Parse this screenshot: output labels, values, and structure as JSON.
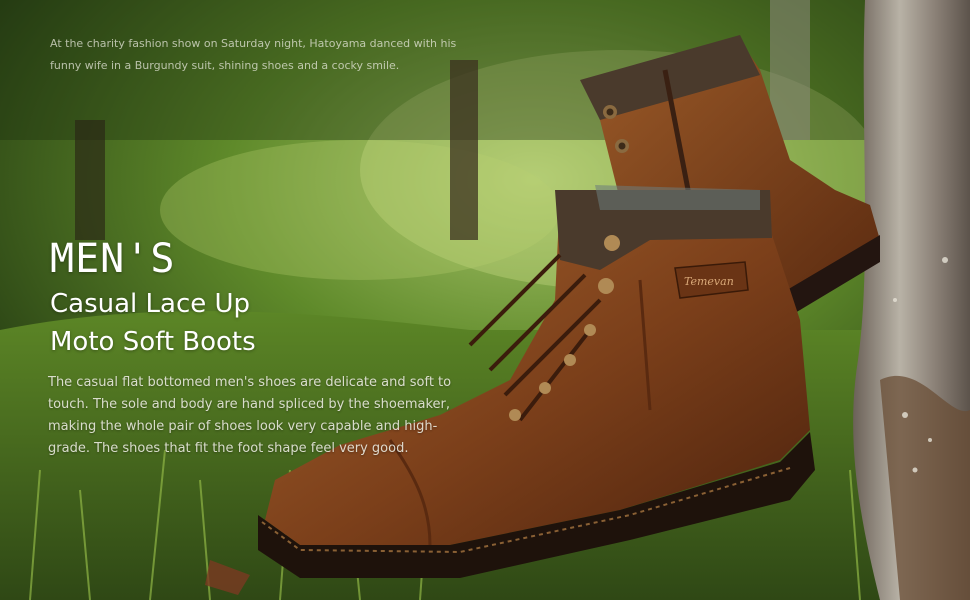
{
  "banner": {
    "quote": "At the charity fashion show on Saturday night, Hatoyama danced with his funny wife in a Burgundy suit, shining shoes and a cocky smile.",
    "headline": "MEN'S",
    "subtitle_line1": "Casual Lace Up",
    "subtitle_line2": "Moto Soft Boots",
    "description": "The casual flat bottomed men's shoes are delicate and soft to touch. The sole and body are hand spliced by the shoemaker, making the whole pair of shoes look very capable and high-grade. The shoes that fit the foot shape feel very good.",
    "brand_tag": "Temevan"
  },
  "colors": {
    "boot_leather": "#8a4a22",
    "boot_collar": "#4a3a2c",
    "grass": "#5f8a2a",
    "sky_bokeh": "#a7c46a"
  }
}
